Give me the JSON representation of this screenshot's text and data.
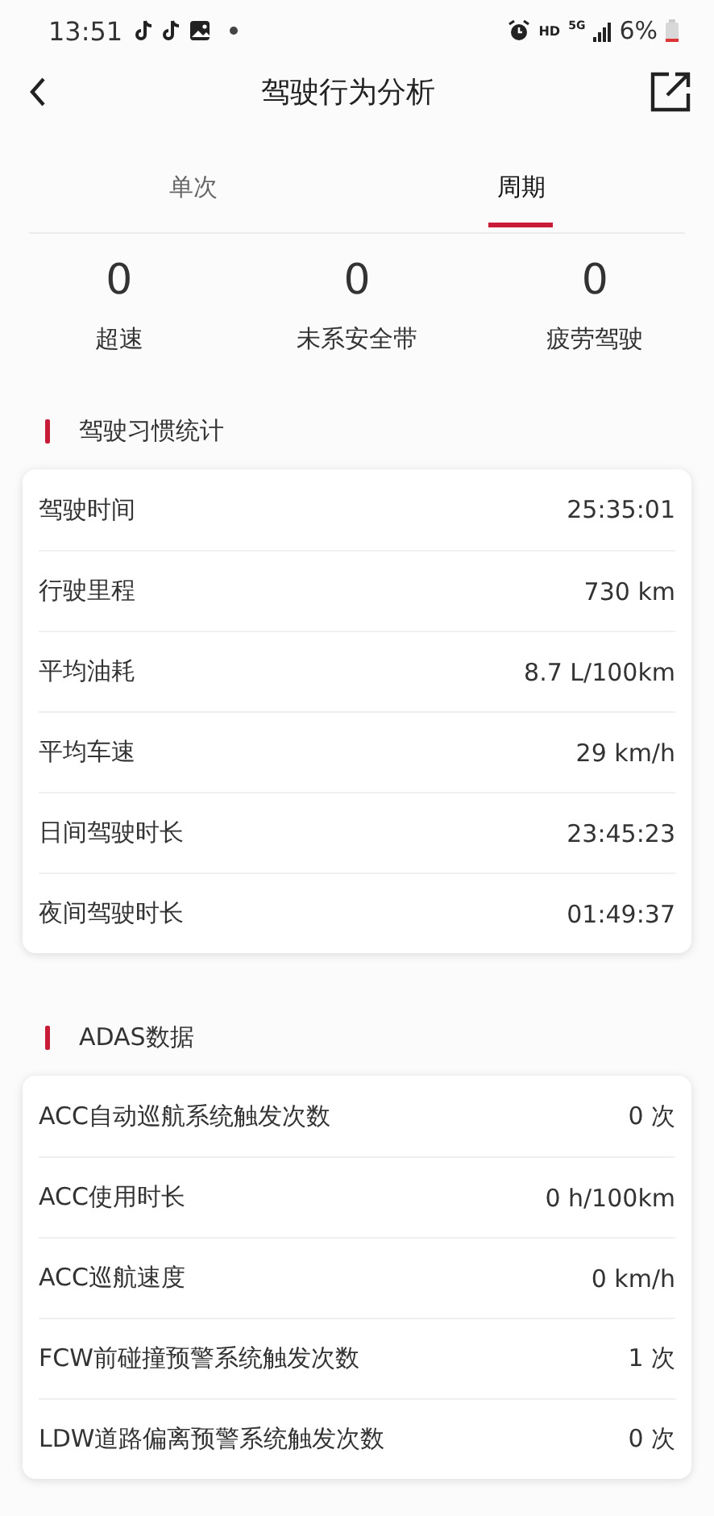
{
  "status_bar": {
    "time": "13:51",
    "network": "HD",
    "generation": "5G",
    "battery": "6%"
  },
  "header": {
    "title": "驾驶行为分析"
  },
  "tabs": [
    {
      "label": "单次",
      "selected": false
    },
    {
      "label": "周期",
      "selected": true
    }
  ],
  "summary": [
    {
      "value": "0",
      "label": "超速"
    },
    {
      "value": "0",
      "label": "未系安全带"
    },
    {
      "value": "0",
      "label": "疲劳驾驶"
    }
  ],
  "sections": [
    {
      "title": "驾驶习惯统计",
      "rows": [
        {
          "label": "驾驶时间",
          "value": "25:35:01"
        },
        {
          "label": "行驶里程",
          "value": "730 km"
        },
        {
          "label": "平均油耗",
          "value": "8.7 L/100km"
        },
        {
          "label": "平均车速",
          "value": "29 km/h"
        },
        {
          "label": "日间驾驶时长",
          "value": "23:45:23"
        },
        {
          "label": "夜间驾驶时长",
          "value": "01:49:37"
        }
      ]
    },
    {
      "title": "ADAS数据",
      "rows": [
        {
          "label": "ACC自动巡航系统触发次数",
          "value": "0 次"
        },
        {
          "label": "ACC使用时长",
          "value": "0 h/100km"
        },
        {
          "label": "ACC巡航速度",
          "value": "0 km/h"
        },
        {
          "label": "FCW前碰撞预警系统触发次数",
          "value": "1 次"
        },
        {
          "label": "LDW道路偏离预警系统触发次数",
          "value": "0 次"
        }
      ]
    }
  ]
}
